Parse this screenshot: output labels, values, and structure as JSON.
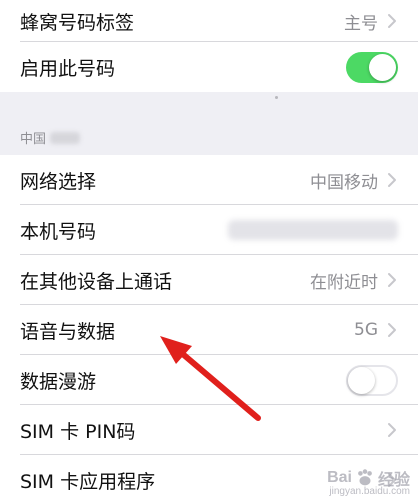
{
  "top_group": {
    "cellular_label": {
      "label": "蜂窝号码标签",
      "value": "主号"
    },
    "enable_line": {
      "label": "启用此号码",
      "toggle": "on"
    }
  },
  "section": {
    "header": "中国"
  },
  "carrier_group": {
    "network_selection": {
      "label": "网络选择",
      "value": "中国移动"
    },
    "my_number": {
      "label": "本机号码"
    },
    "calls_other_devices": {
      "label": "在其他设备上通话",
      "value": "在附近时"
    },
    "voice_data": {
      "label": "语音与数据",
      "value": "5G"
    },
    "data_roaming": {
      "label": "数据漫游",
      "toggle": "off"
    },
    "sim_pin": {
      "label": "SIM 卡 PIN码"
    },
    "sim_apps": {
      "label": "SIM 卡应用程序"
    }
  },
  "colors": {
    "toggle_on": "#4cd964",
    "annotation_arrow": "#e0201c",
    "background": "#efeff4"
  },
  "watermark": {
    "brand": "Bai",
    "brand2": "经验",
    "sub": "jingyan.baidu.com"
  }
}
